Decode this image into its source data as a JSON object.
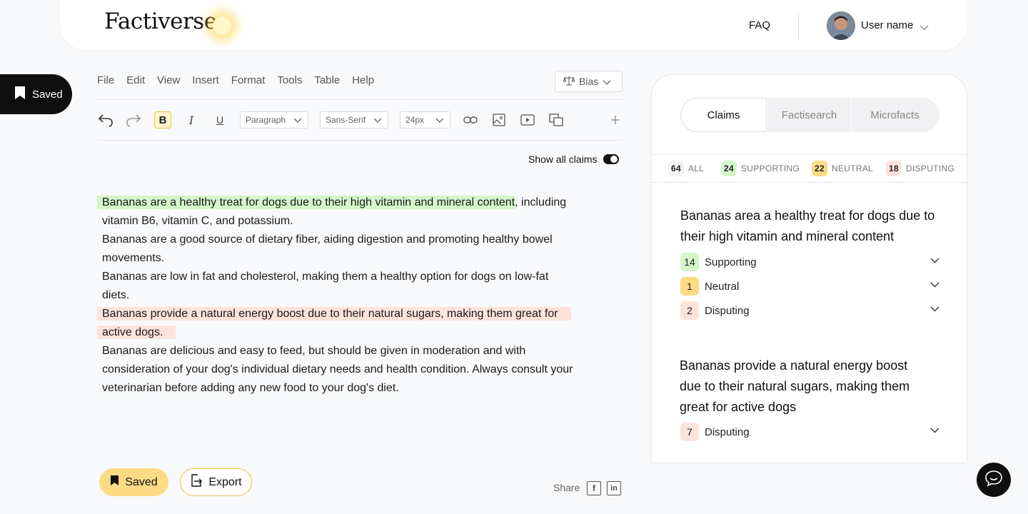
{
  "header": {
    "logo": "Factiverse",
    "faq": "FAQ",
    "user_name": "User name"
  },
  "side_saved": {
    "label": "Saved"
  },
  "menu": [
    "File",
    "Edit",
    "View",
    "Insert",
    "Format",
    "Tools",
    "Table",
    "Help"
  ],
  "bias": {
    "label": "Bias"
  },
  "toolbar": {
    "bold": "B",
    "italic": "I",
    "underline": "U",
    "block_style": "Paragraph",
    "font_family": "Sans-Serif",
    "font_size": "24px"
  },
  "show_all_claims": {
    "label": "Show all claims",
    "enabled": true
  },
  "document": {
    "p1_highlight": "Bananas are a healthy treat for dogs due to their high vitamin and mineral content",
    "p1_rest": ", including vitamin B6, vitamin C, and potassium.",
    "p2": "Bananas are a good source of dietary fiber, aiding digestion and promoting healthy bowel movements.",
    "p3": "Bananas are low in fat and cholesterol, making them a healthy option for dogs on low-fat diets.",
    "p4_highlight": "Bananas provide a natural energy boost due to their natural sugars, making them great for active dogs.",
    "p5": "Bananas are delicious and easy to feed, but should be given in moderation and with consideration of your dog's individual dietary needs and health condition. Always consult your veterinarian before adding any new food to your dog's diet."
  },
  "bottom": {
    "saved_label": "Saved",
    "export_label": "Export",
    "share_label": "Share"
  },
  "panel": {
    "tabs": [
      "Claims",
      "Factisearch",
      "Microfacts"
    ],
    "active_tab": "Claims",
    "filters": [
      {
        "count": "64",
        "label": "ALL"
      },
      {
        "count": "24",
        "label": "SUPPORTING"
      },
      {
        "count": "22",
        "label": "NEUTRAL"
      },
      {
        "count": "18",
        "label": "DISPUTING"
      }
    ],
    "claims": [
      {
        "title": "Bananas area a healthy treat for dogs due to their high vitamin and mineral content",
        "rows": [
          {
            "count": "14",
            "label": "Supporting"
          },
          {
            "count": "1",
            "label": "Neutral"
          },
          {
            "count": "2",
            "label": "Disputing"
          }
        ]
      },
      {
        "title": "Bananas provide a natural energy boost due to their natural sugars, making them great for active dogs",
        "rows": [
          {
            "count": "7",
            "label": "Disputing"
          }
        ]
      }
    ]
  },
  "colors": {
    "supporting": "#d4f6c9",
    "neutral": "#fcdb84",
    "disputing": "#fde3da",
    "accent": "#e8c43a"
  }
}
